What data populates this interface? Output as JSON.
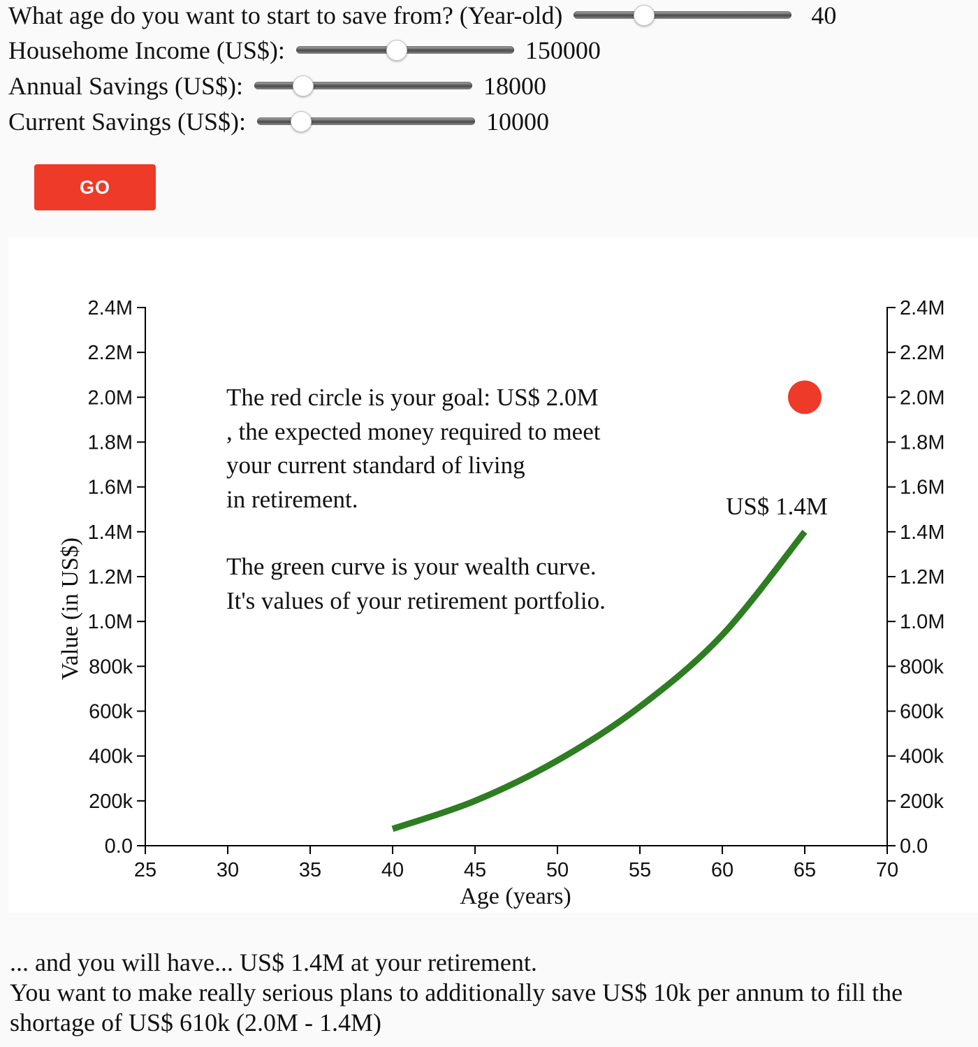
{
  "controls": {
    "age": {
      "label": "What age do you want to start to save from? (Year-old)",
      "value": "40",
      "position": 0.32
    },
    "income": {
      "label": "Househome Income (US$):",
      "value": "150000",
      "position": 0.46
    },
    "annual_savings": {
      "label": "Annual Savings (US$):",
      "value": "18000",
      "position": 0.22
    },
    "current_savings": {
      "label": "Current Savings (US$):",
      "value": "10000",
      "position": 0.2
    }
  },
  "go_button": {
    "label": "GO"
  },
  "chart_data": {
    "type": "line",
    "xlabel": "Age (years)",
    "ylabel": "Value (in US$)",
    "xlim": [
      25,
      70
    ],
    "ylim": [
      0,
      2400000
    ],
    "x_ticks": [
      "25",
      "30",
      "35",
      "40",
      "45",
      "50",
      "55",
      "60",
      "65",
      "70"
    ],
    "y_ticks": [
      "0.0",
      "200k",
      "400k",
      "600k",
      "800k",
      "1.0M",
      "1.2M",
      "1.4M",
      "1.6M",
      "1.8M",
      "2.0M",
      "2.2M",
      "2.4M"
    ],
    "series": [
      {
        "color": "#2e7d22",
        "x": [
          40,
          45,
          50,
          55,
          60,
          65
        ],
        "y": [
          75000,
          200000,
          380000,
          620000,
          940000,
          1400000
        ]
      }
    ],
    "goal": {
      "x": 65,
      "y": 2000000,
      "color": "#ee3a28"
    },
    "end_label": "US$ 1.4M",
    "annotation_lines": [
      "The red circle is your goal: US$ 2.0M",
      ", the expected money required to meet",
      "your current standard of living",
      "in retirement.",
      "The green curve is your wealth curve.",
      "It's values of your retirement portfolio."
    ]
  },
  "summary": {
    "line1": "... and you will have... US$ 1.4M at your retirement.",
    "line2": "You want to make really serious plans to additionally save US$ 10k per annum to fill the shortage of US$ 610k (2.0M - 1.4M)"
  }
}
